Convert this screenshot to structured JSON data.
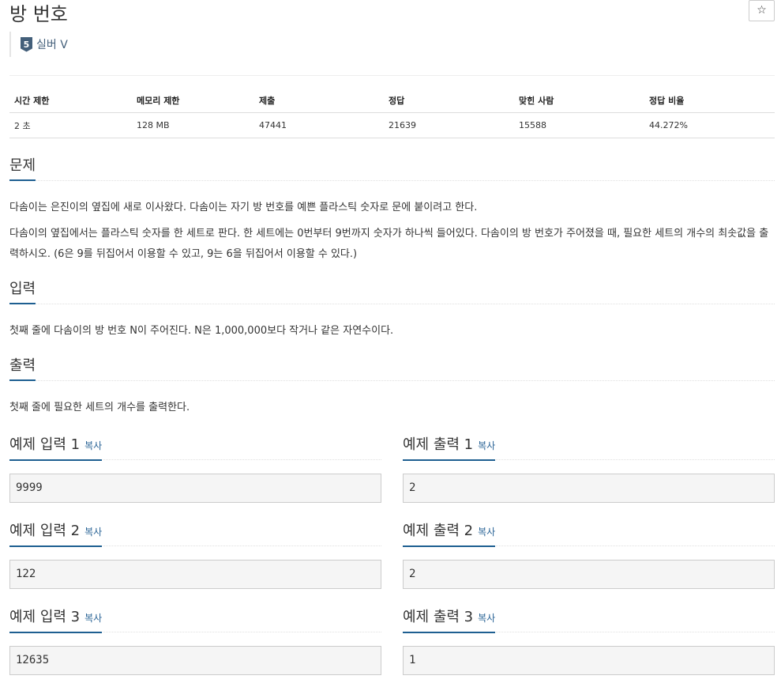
{
  "problem": {
    "title": "방 번호",
    "star_icon": "☆",
    "tier_badge": "5",
    "tier_label": "실버 V"
  },
  "info_table": {
    "headers": [
      "시간 제한",
      "메모리 제한",
      "제출",
      "정답",
      "맞힌 사람",
      "정답 비율"
    ],
    "values": [
      "2 초",
      "128 MB",
      "47441",
      "21639",
      "15588",
      "44.272%"
    ]
  },
  "sections": {
    "description": {
      "heading": "문제",
      "paragraphs": [
        "다솜이는 은진이의 옆집에 새로 이사왔다. 다솜이는 자기 방 번호를 예쁜 플라스틱 숫자로 문에 붙이려고 한다.",
        "다솜이의 옆집에서는 플라스틱 숫자를 한 세트로 판다. 한 세트에는 0번부터 9번까지 숫자가 하나씩 들어있다. 다솜이의 방 번호가 주어졌을 때, 필요한 세트의 개수의 최솟값을 출력하시오. (6은 9를 뒤집어서 이용할 수 있고, 9는 6을 뒤집어서 이용할 수 있다.)"
      ]
    },
    "input": {
      "heading": "입력",
      "text": "첫째 줄에 다솜이의 방 번호 N이 주어진다. N은 1,000,000보다 작거나 같은 자연수이다."
    },
    "output": {
      "heading": "출력",
      "text": "첫째 줄에 필요한 세트의 개수를 출력한다."
    }
  },
  "samples": {
    "copy_label": "복사",
    "inputs": [
      {
        "heading": "예제 입력 1",
        "value": "9999"
      },
      {
        "heading": "예제 입력 2",
        "value": "122"
      },
      {
        "heading": "예제 입력 3",
        "value": "12635"
      }
    ],
    "outputs": [
      {
        "heading": "예제 출력 1",
        "value": "2"
      },
      {
        "heading": "예제 출력 2",
        "value": "2"
      },
      {
        "heading": "예제 출력 3",
        "value": "1"
      }
    ]
  }
}
